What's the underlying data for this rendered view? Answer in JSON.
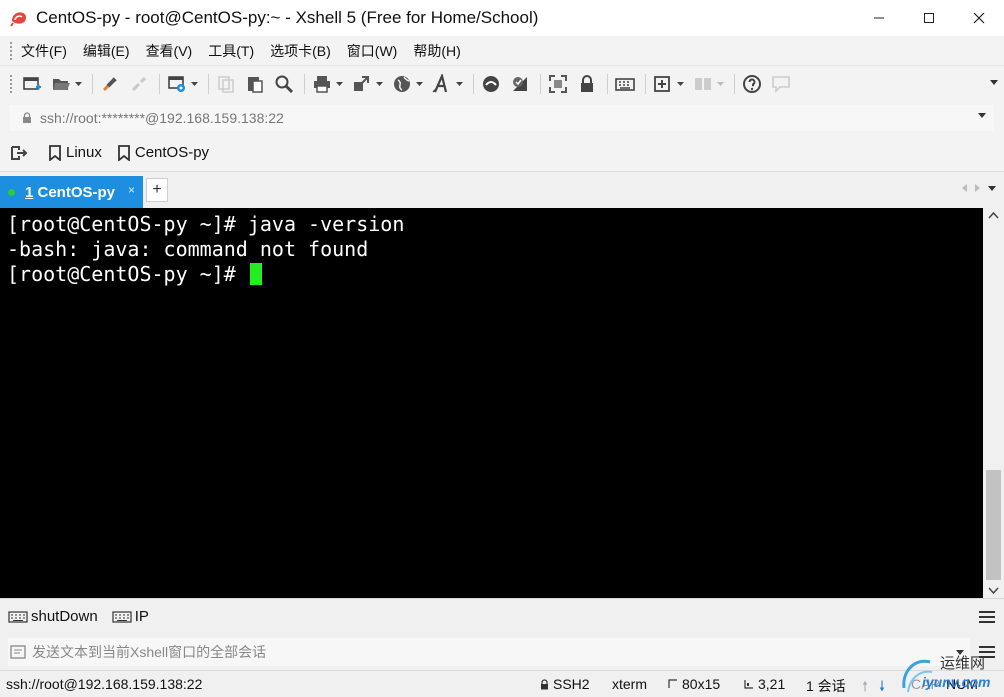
{
  "window": {
    "title": "CentOS-py - root@CentOS-py:~ - Xshell 5 (Free for Home/School)"
  },
  "menu": {
    "items": [
      "文件(F)",
      "编辑(E)",
      "查看(V)",
      "工具(T)",
      "选项卡(B)",
      "窗口(W)",
      "帮助(H)"
    ]
  },
  "address": {
    "value": "ssh://root:********@192.168.159.138:22"
  },
  "links": {
    "items": [
      "Linux",
      "CentOS-py"
    ]
  },
  "tabs": {
    "active": {
      "number": "1",
      "label": " CentOS-py",
      "status_color": "#25d02f"
    },
    "add_label": "+",
    "close_label": "×"
  },
  "terminal": {
    "lines": [
      "[root@CentOS-py ~]# java -version",
      "-bash: java: command not found",
      "[root@CentOS-py ~]# "
    ],
    "cursor_color": "#22ee22",
    "background": "#000000",
    "foreground": "#ffffff"
  },
  "quick_commands": {
    "items": [
      "shutDown",
      "IP"
    ]
  },
  "compose": {
    "placeholder": "发送文本到当前Xshell窗口的全部会话"
  },
  "status": {
    "connection": "ssh://root@192.168.159.138:22",
    "protocol": "SSH2",
    "terminal_type": "xterm",
    "size": "80x15",
    "cursor_pos": "3,21",
    "sessions": "1 会话",
    "caps": "CAP",
    "num": "NUM"
  },
  "watermark": {
    "text": "运维网",
    "sub": "iyunv.com"
  },
  "colors": {
    "accent": "#1e8ee0",
    "chrome": "#f3f3f3"
  }
}
